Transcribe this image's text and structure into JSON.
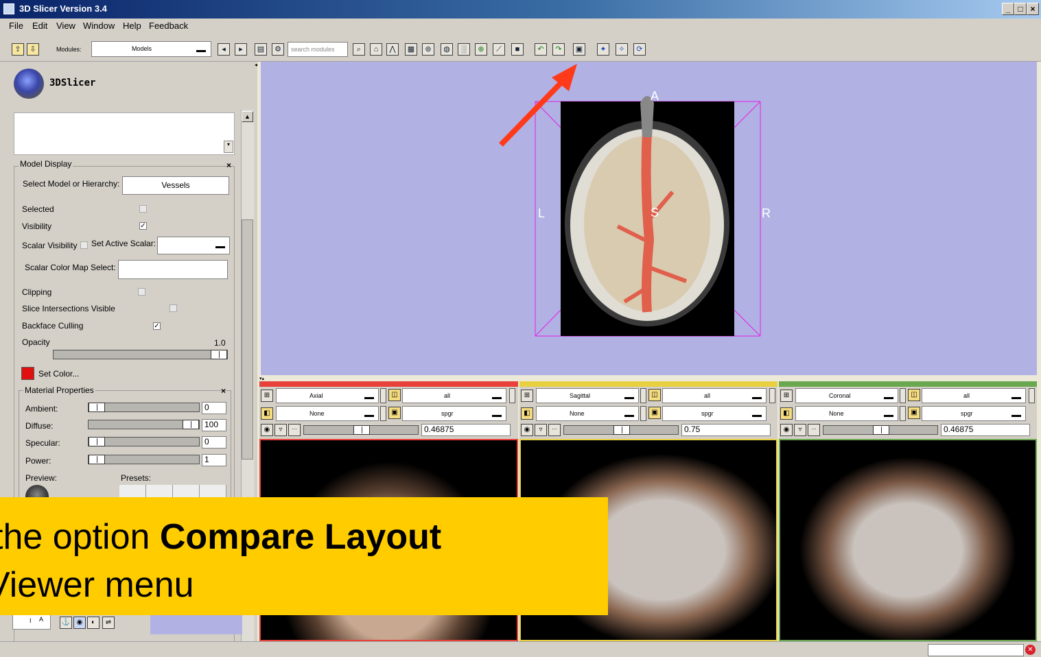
{
  "window": {
    "title": "3D Slicer Version 3.4",
    "min": "_",
    "max": "□",
    "close": "×"
  },
  "menu": [
    "File",
    "Edit",
    "View",
    "Window",
    "Help",
    "Feedback"
  ],
  "toolbar": {
    "modules_label": "Modules:",
    "module_selected": "Models",
    "search_placeholder": "search modules"
  },
  "logo": {
    "text": "3DSlicer"
  },
  "model_display": {
    "title": "Model Display",
    "close": "×",
    "select_label": "Select Model or Hierarchy:",
    "select_value": "Vessels",
    "selected_label": "Selected",
    "visibility_label": "Visibility",
    "scalar_visibility_label": "Scalar Visibility",
    "set_active_scalar_label": "Set Active Scalar:",
    "scalar_color_map_label": "Scalar Color Map Select:",
    "clipping_label": "Clipping",
    "slice_intersections_label": "Slice Intersections Visible",
    "backface_culling_label": "Backface Culling",
    "opacity_label": "Opacity",
    "opacity_value": "1.0",
    "set_color_label": "Set Color...",
    "color": "#e01010"
  },
  "material": {
    "title": "Material Properties",
    "close": "×",
    "ambient_label": "Ambient:",
    "ambient_value": "0",
    "diffuse_label": "Diffuse:",
    "diffuse_value": "100",
    "specular_label": "Specular:",
    "specular_value": "0",
    "power_label": "Power:",
    "power_value": "1",
    "preview_label": "Preview:",
    "presets_label": "Presets:"
  },
  "viewer3d": {
    "bg": "#b1b1e4",
    "labels": {
      "A": "A",
      "L": "L",
      "R": "R",
      "S": "S"
    }
  },
  "slices": [
    {
      "name": "Axial",
      "fg": "all",
      "bg_layer": "None",
      "label_layer": "spgr",
      "offset": "0.46875",
      "color": "#e8413a"
    },
    {
      "name": "Sagittal",
      "fg": "all",
      "bg_layer": "None",
      "label_layer": "spgr",
      "offset": "0.75",
      "color": "#e8d040"
    },
    {
      "name": "Coronal",
      "fg": "all",
      "bg_layer": "None",
      "label_layer": "spgr",
      "offset": "0.46875",
      "color": "#6aa84f"
    }
  ],
  "bottom_left": {
    "label": "I",
    "label2": "A"
  },
  "overlay": {
    "line1_a": "the option ",
    "line1_b": "Compare Layout",
    "line2": "Viewer menu",
    "bg": "#ffcc00"
  },
  "annotation_arrow_color": "#ff3a1a"
}
